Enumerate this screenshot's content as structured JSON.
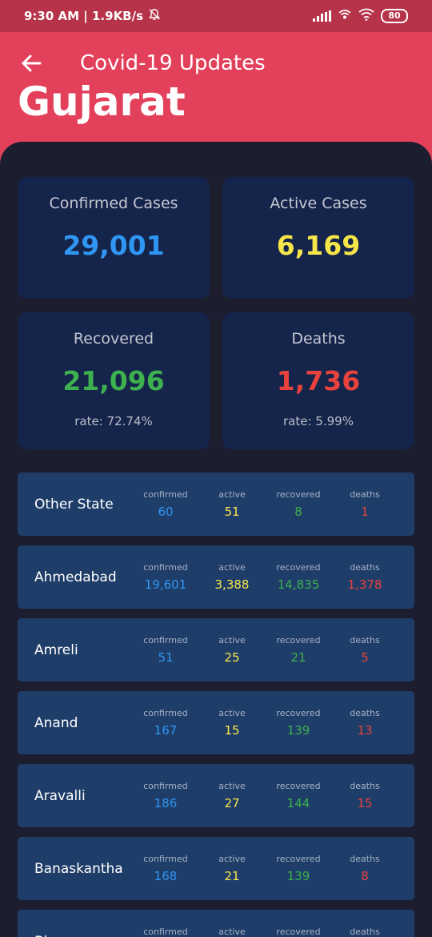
{
  "status_bar": {
    "left": "9:30 AM | 1.9KB/s",
    "battery": "80"
  },
  "header": {
    "title": "Covid-19 Updates",
    "region": "Gujarat"
  },
  "colors": {
    "confirmed": "#2f96f3",
    "active": "#f6e64a",
    "recovered": "#3db14d",
    "deaths": "#e8423d"
  },
  "summary": {
    "confirmed": {
      "label": "Confirmed Cases",
      "value": "29,001"
    },
    "active": {
      "label": "Active Cases",
      "value": "6,169"
    },
    "recovered": {
      "label": "Recovered",
      "value": "21,096",
      "rate": "rate: 72.74%"
    },
    "deaths": {
      "label": "Deaths",
      "value": "1,736",
      "rate": "rate: 5.99%"
    }
  },
  "column_headers": {
    "confirmed": "confirmed",
    "active": "active",
    "recovered": "recovered",
    "deaths": "deaths"
  },
  "districts": [
    {
      "name": "Other State",
      "confirmed": "60",
      "active": "51",
      "recovered": "8",
      "deaths": "1"
    },
    {
      "name": "Ahmedabad",
      "confirmed": "19,601",
      "active": "3,388",
      "recovered": "14,835",
      "deaths": "1,378"
    },
    {
      "name": "Amreli",
      "confirmed": "51",
      "active": "25",
      "recovered": "21",
      "deaths": "5"
    },
    {
      "name": "Anand",
      "confirmed": "167",
      "active": "15",
      "recovered": "139",
      "deaths": "13"
    },
    {
      "name": "Aravalli",
      "confirmed": "186",
      "active": "27",
      "recovered": "144",
      "deaths": "15"
    },
    {
      "name": "Banaskantha",
      "confirmed": "168",
      "active": "21",
      "recovered": "139",
      "deaths": "8"
    },
    {
      "name": "Bhavnagar",
      "confirmed": "",
      "active": "",
      "recovered": "",
      "deaths": ""
    }
  ]
}
